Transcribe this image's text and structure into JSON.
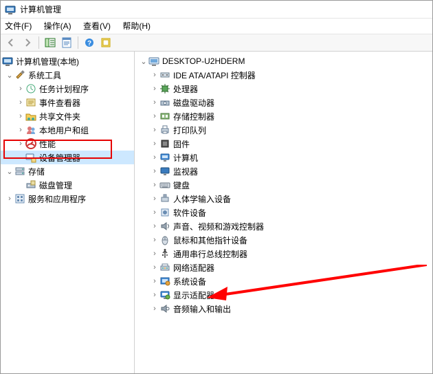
{
  "window": {
    "title": "计算机管理"
  },
  "menu": {
    "file": "文件(F)",
    "action": "操作(A)",
    "view": "查看(V)",
    "help": "帮助(H)"
  },
  "toolbar": {
    "back": "back",
    "forward": "forward",
    "up": "up",
    "show_hide": "show-hide-console-tree",
    "properties": "properties",
    "help": "help",
    "refresh": "refresh"
  },
  "left_tree": {
    "root": "计算机管理(本地)",
    "system_tools": "系统工具",
    "children": {
      "task_scheduler": "任务计划程序",
      "event_viewer": "事件查看器",
      "shared_folders": "共享文件夹",
      "local_users": "本地用户和组",
      "performance": "性能",
      "device_manager": "设备管理器"
    },
    "storage": "存储",
    "disk_mgmt": "磁盘管理",
    "services_apps": "服务和应用程序"
  },
  "right_tree": {
    "root": "DESKTOP-U2HDERM",
    "items": [
      {
        "id": "ide",
        "label": "IDE ATA/ATAPI 控制器"
      },
      {
        "id": "cpu",
        "label": "处理器"
      },
      {
        "id": "diskdrive",
        "label": "磁盘驱动器"
      },
      {
        "id": "storage-ctrl",
        "label": "存储控制器"
      },
      {
        "id": "print-queue",
        "label": "打印队列"
      },
      {
        "id": "firmware",
        "label": "固件"
      },
      {
        "id": "computer",
        "label": "计算机"
      },
      {
        "id": "monitor",
        "label": "监视器"
      },
      {
        "id": "keyboard",
        "label": "键盘"
      },
      {
        "id": "hid",
        "label": "人体学输入设备"
      },
      {
        "id": "software-dev",
        "label": "软件设备"
      },
      {
        "id": "audio-video-game",
        "label": "声音、视频和游戏控制器"
      },
      {
        "id": "mouse",
        "label": "鼠标和其他指针设备"
      },
      {
        "id": "usb",
        "label": "通用串行总线控制器"
      },
      {
        "id": "network",
        "label": "网络适配器"
      },
      {
        "id": "system-dev",
        "label": "系统设备"
      },
      {
        "id": "display",
        "label": "显示适配器"
      },
      {
        "id": "audio-io",
        "label": "音频输入和输出"
      }
    ]
  },
  "annotation": {
    "highlight_target": "device_manager",
    "arrow_target": "display"
  }
}
